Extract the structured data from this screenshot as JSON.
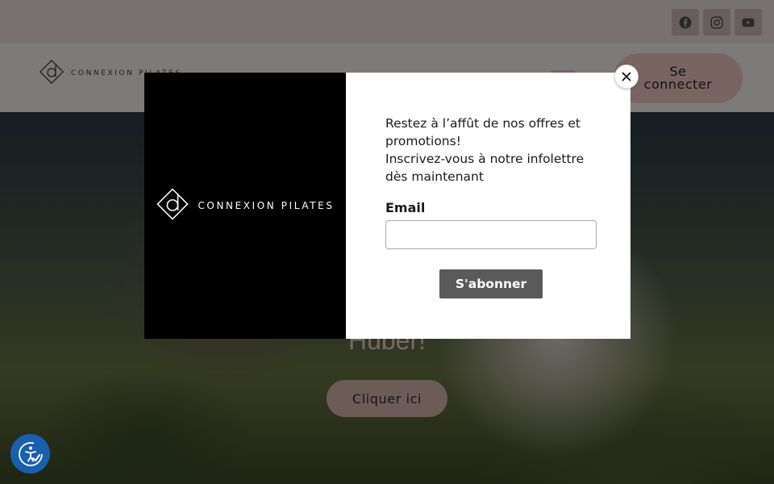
{
  "topbar": {
    "social": [
      {
        "icon": "facebook-icon"
      },
      {
        "icon": "instagram-icon"
      },
      {
        "icon": "youtube-icon"
      }
    ]
  },
  "header": {
    "brand_name": "CONNEXION  PILATES",
    "login_label": "Se connecter"
  },
  "hero": {
    "title": "Huber!",
    "cta_label": "Cliquer ici"
  },
  "modal": {
    "brand_name": "CONNEXION  PILATES",
    "intro_line1": "Restez à l’affût de nos offres et promotions!",
    "intro_line2": "Inscrivez-vous à notre infolettre dès maintenant",
    "email_label": "Email",
    "email_value": "",
    "subscribe_label": "S'abonner",
    "close_icon": "close-icon"
  },
  "accessibility": {
    "icon": "accessibility-icon",
    "color": "#1a5fae"
  }
}
